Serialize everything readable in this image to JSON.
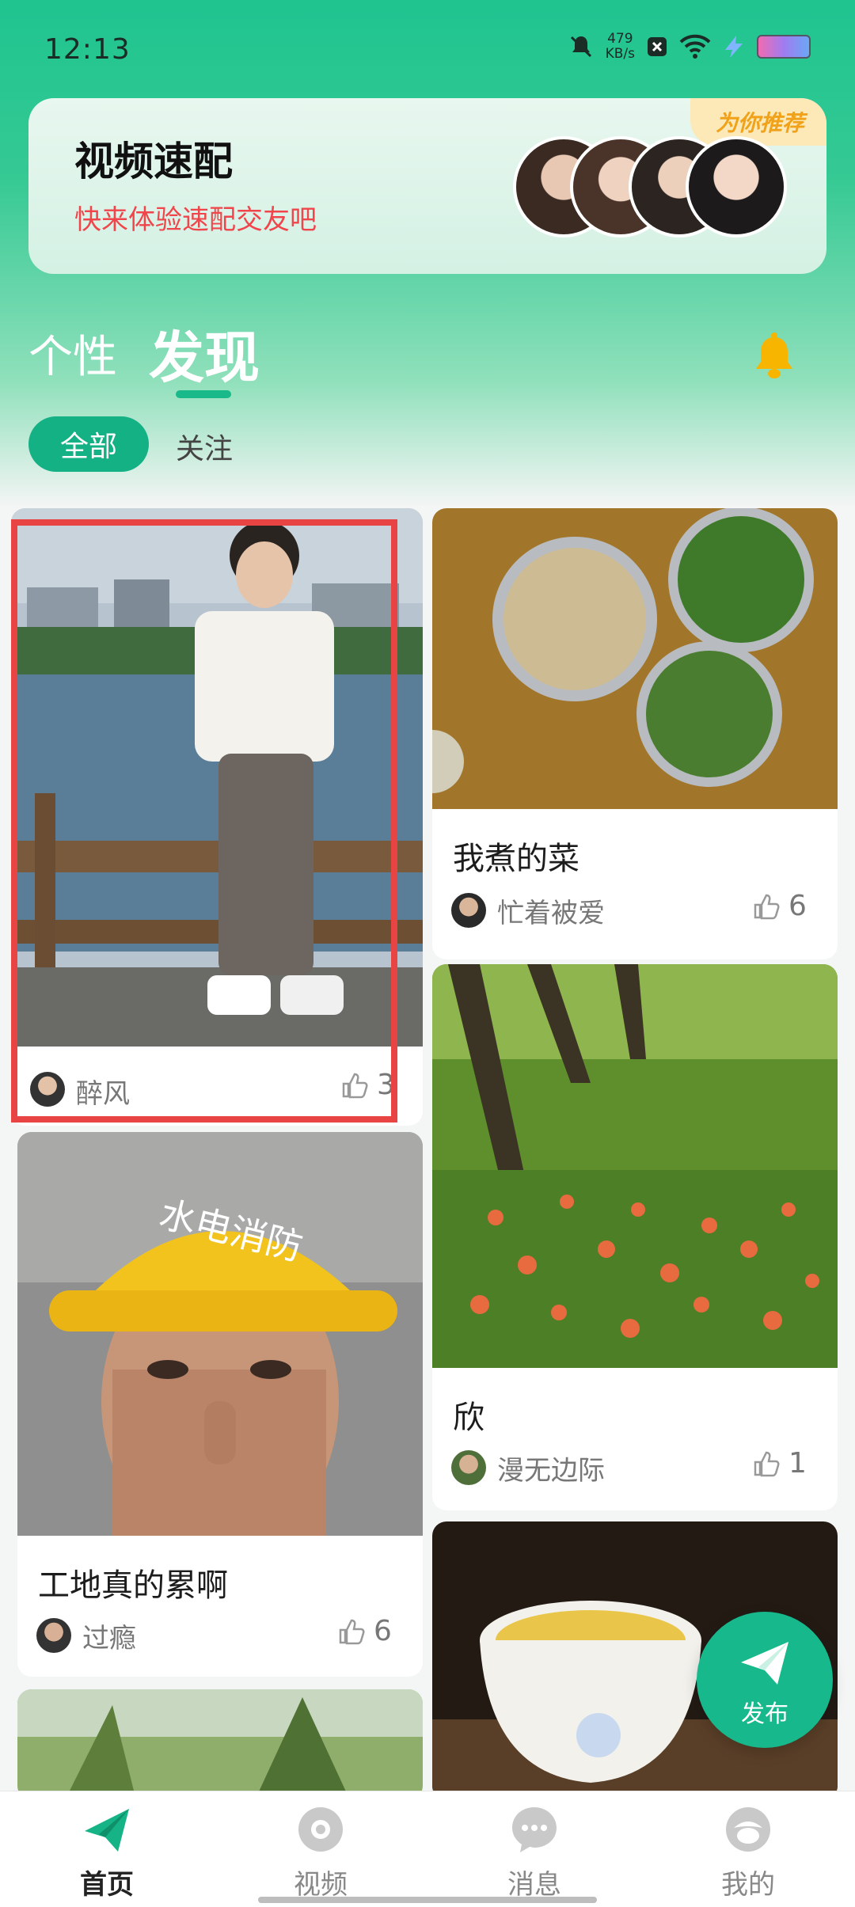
{
  "status_bar": {
    "time": "12:13",
    "speed_value": "479",
    "speed_unit": "KB/s"
  },
  "banner": {
    "title": "视频速配",
    "subtitle": "快来体验速配交友吧",
    "badge": "为你推荐"
  },
  "tabs": {
    "personal": "个性",
    "discover": "发现"
  },
  "filters": {
    "all": "全部",
    "follow": "关注"
  },
  "feed": {
    "card1": {
      "user": "醉风",
      "likes": "3"
    },
    "card2": {
      "title": "我煮的菜",
      "user": "忙着被爱",
      "likes": "6"
    },
    "card3": {
      "title": "欣",
      "user": "漫无边际",
      "likes": "1"
    },
    "card4": {
      "title": "工地真的累啊",
      "user": "过瘾",
      "likes": "6",
      "helmet_text": "水电消防"
    }
  },
  "fab": {
    "label": "发布"
  },
  "nav": {
    "home": "首页",
    "video": "视频",
    "messages": "消息",
    "mine": "我的"
  },
  "colors": {
    "accent": "#13b184",
    "highlight": "#e94444",
    "subtitle_red": "#f0454b"
  }
}
